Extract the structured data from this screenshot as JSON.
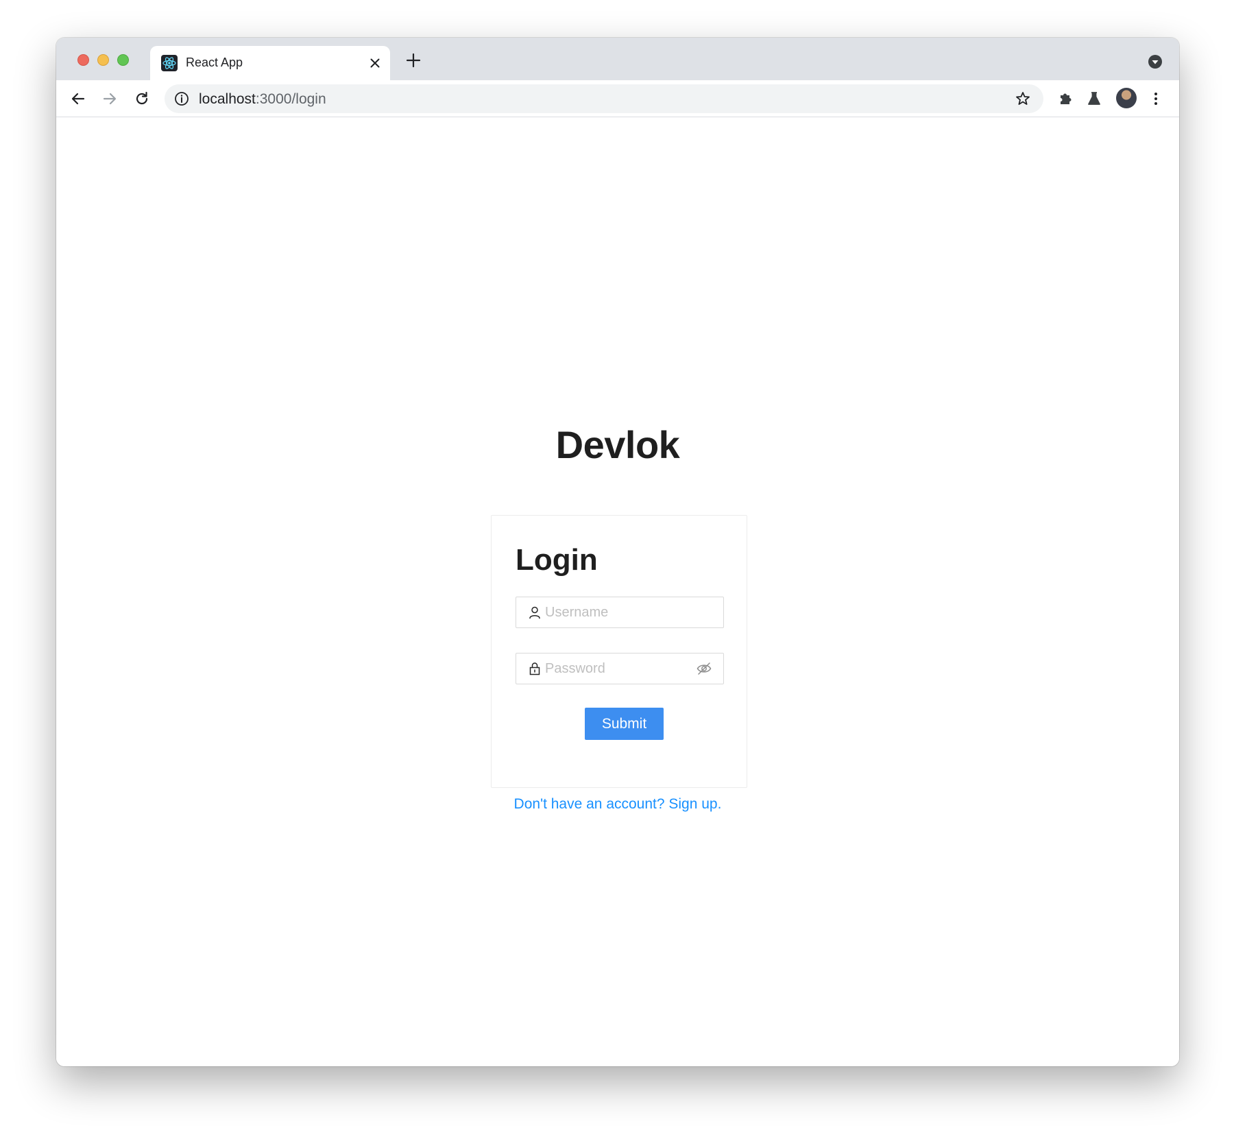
{
  "browser": {
    "tab": {
      "title": "React App",
      "favicon": "react-logo-icon"
    },
    "toolbar": {
      "back_icon": "back-arrow-icon",
      "forward_icon": "forward-arrow-icon",
      "reload_icon": "reload-icon",
      "info_icon": "site-info-icon",
      "bookmark_icon": "star-icon",
      "extensions_icon": "puzzle-icon",
      "labs_icon": "flask-icon",
      "menu_icon": "kebab-menu-icon"
    },
    "address": {
      "host": "localhost",
      "path": ":3000/login"
    }
  },
  "page": {
    "brand": "Devlok",
    "card": {
      "title": "Login",
      "username_placeholder": "Username",
      "password_placeholder": "Password",
      "submit_label": "Submit"
    },
    "signup_link": "Don't have an account? Sign up."
  },
  "colors": {
    "primary_button": "#3d8ef0",
    "link": "#1890ff",
    "tabstrip": "#dee1e6",
    "text_dark": "#1f1f1f"
  }
}
